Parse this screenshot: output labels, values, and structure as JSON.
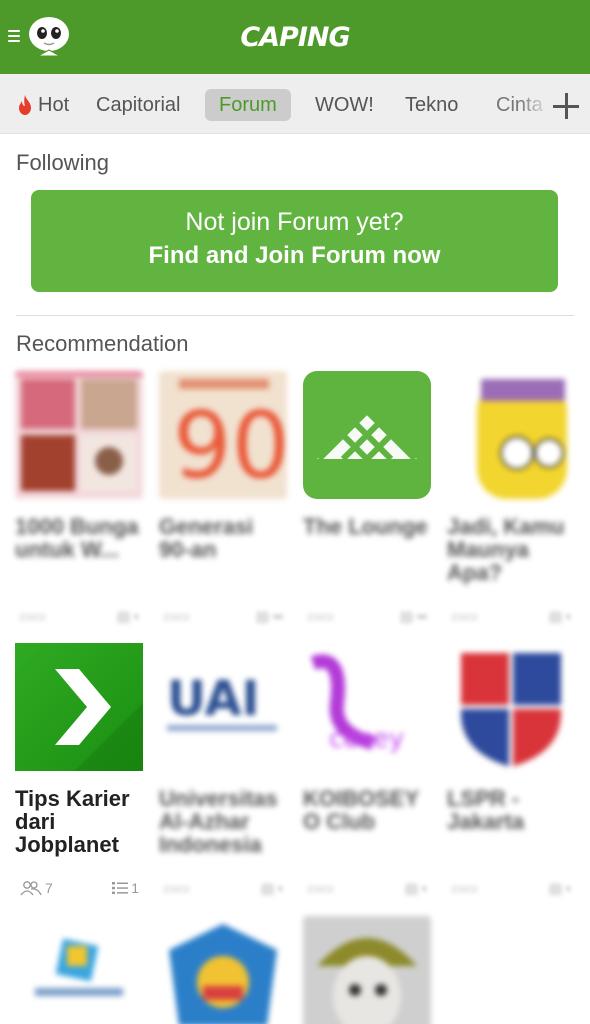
{
  "header": {
    "brand": "CAPING"
  },
  "tabs": [
    {
      "label": "Hot",
      "active": false
    },
    {
      "label": "Capitorial",
      "active": false
    },
    {
      "label": "Forum",
      "active": true
    },
    {
      "label": "WOW!",
      "active": false
    },
    {
      "label": "Tekno",
      "active": false
    },
    {
      "label": "Cinta",
      "active": false
    }
  ],
  "following": {
    "title": "Following",
    "join_line1": "Not join Forum yet?",
    "join_line2": "Find and Join Forum now"
  },
  "recommendation": {
    "title": "Recommendation",
    "row1": [
      {
        "title": "1000 Bunga untuk W...",
        "members": "",
        "posts": ""
      },
      {
        "title": "Generasi 90-an",
        "members": "",
        "posts": ""
      },
      {
        "title": "The Lounge",
        "members": "",
        "posts": ""
      },
      {
        "title": "Jadi, Kamu Maunya Apa?",
        "members": "",
        "posts": ""
      }
    ],
    "row2": [
      {
        "title": "Tips Karier dari Jobplanet",
        "members": "7",
        "posts": "1"
      },
      {
        "title": "Universitas Al-Azhar Indonesia",
        "members": "",
        "posts": ""
      },
      {
        "title": "KOIBOSEY O Club",
        "members": "",
        "posts": ""
      },
      {
        "title": "LSPR - Jakarta",
        "members": "",
        "posts": ""
      }
    ]
  },
  "colors": {
    "brand_green": "#4d9a2a",
    "button_green": "#62b441",
    "active_tab_bg": "#cccccc"
  }
}
